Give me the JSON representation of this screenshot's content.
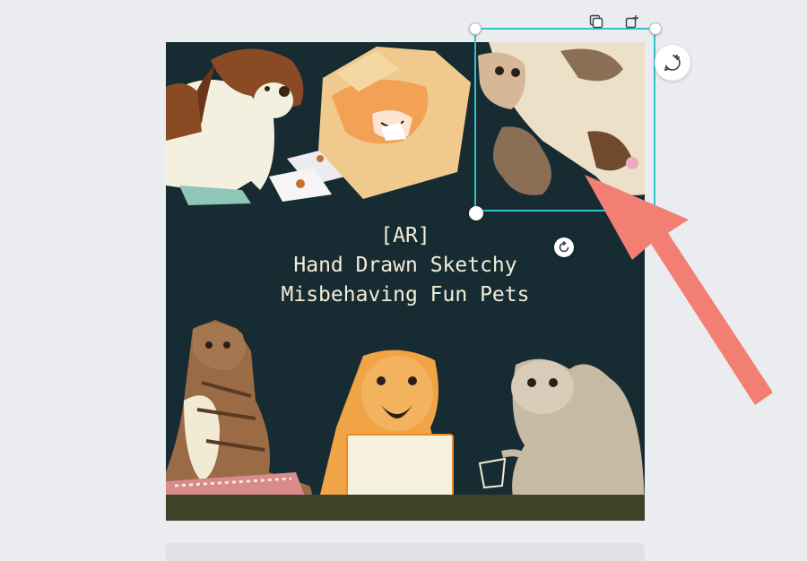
{
  "canvas": {
    "caption_line1": "[AR]",
    "caption_line2": "Hand Drawn Sketchy",
    "caption_line3": "Misbehaving Fun Pets",
    "background_color": "#172b33"
  },
  "illustrations": [
    "basset-hound-dog",
    "cat-in-box",
    "calico-cat",
    "tabby-cat",
    "golden-retriever",
    "persian-cat"
  ],
  "toolbar_icons": [
    "duplicate-icon",
    "add-page-icon",
    "add-comment-icon",
    "rotate-icon"
  ],
  "colors": {
    "selection": "#2bc4c8",
    "arrow": "#f37f74"
  }
}
